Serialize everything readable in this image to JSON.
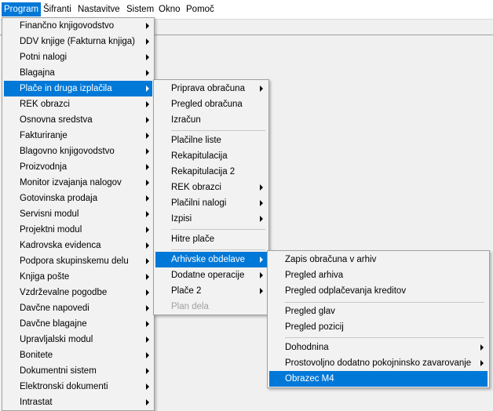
{
  "menubar": {
    "items": [
      {
        "label": "Program",
        "active": true
      },
      {
        "label": "Šifranti"
      },
      {
        "label": "Nastavitve"
      },
      {
        "label": "Sistem"
      },
      {
        "label": "Okno"
      },
      {
        "label": "Pomoč"
      }
    ]
  },
  "program_menu": {
    "items": [
      {
        "label": "Finančno knjigovodstvo"
      },
      {
        "label": "DDV knjige (Fakturna knjiga)"
      },
      {
        "label": "Potni nalogi"
      },
      {
        "label": "Blagajna"
      },
      {
        "label": "Plače in druga izplačila",
        "highlighted": true
      },
      {
        "label": "REK obrazci"
      },
      {
        "label": "Osnovna sredstva"
      },
      {
        "label": "Fakturiranje"
      },
      {
        "label": "Blagovno knjigovodstvo"
      },
      {
        "label": "Proizvodnja"
      },
      {
        "label": "Monitor izvajanja nalogov"
      },
      {
        "label": "Gotovinska prodaja"
      },
      {
        "label": "Servisni modul"
      },
      {
        "label": "Projektni modul"
      },
      {
        "label": "Kadrovska evidenca"
      },
      {
        "label": "Podpora skupinskemu delu"
      },
      {
        "label": "Knjiga pošte"
      },
      {
        "label": "Vzdrževalne pogodbe"
      },
      {
        "label": "Davčne napovedi"
      },
      {
        "label": "Davčne blagajne"
      },
      {
        "label": "Upravljalski modul"
      },
      {
        "label": "Bonitete"
      },
      {
        "label": "Dokumentni sistem"
      },
      {
        "label": "Elektronski dokumenti"
      },
      {
        "label": "Intrastat"
      }
    ]
  },
  "place_menu": {
    "items": [
      {
        "label": "Priprava obračuna",
        "submenu": true
      },
      {
        "label": "Pregled obračuna"
      },
      {
        "label": "Izračun"
      },
      {
        "label": "Plačilne liste"
      },
      {
        "label": "Rekapitulacija"
      },
      {
        "label": "Rekapitulacija 2"
      },
      {
        "label": "REK obrazci",
        "submenu": true
      },
      {
        "label": "Plačilni nalogi",
        "submenu": true
      },
      {
        "label": "Izpisi",
        "submenu": true
      },
      {
        "label": "Hitre plače"
      },
      {
        "label": "Arhivske obdelave",
        "submenu": true,
        "highlighted": true
      },
      {
        "label": "Dodatne operacije",
        "submenu": true
      },
      {
        "label": "Plače 2",
        "submenu": true
      },
      {
        "label": "Plan dela",
        "disabled": true
      }
    ]
  },
  "arhiv_menu": {
    "items": [
      {
        "label": "Zapis obračuna v arhiv"
      },
      {
        "label": "Pregled arhiva"
      },
      {
        "label": "Pregled odplačevanja kreditov"
      },
      {
        "label": "Pregled glav"
      },
      {
        "label": "Pregled pozicij"
      },
      {
        "label": "Dohodnina",
        "submenu": true
      },
      {
        "label": "Prostovoljno dodatno pokojninsko zavarovanje",
        "submenu": true
      },
      {
        "label": "Obrazec M4",
        "highlighted": true
      }
    ]
  },
  "colors": {
    "accent": "#0078d7",
    "menu_bg": "#f2f2f2"
  }
}
